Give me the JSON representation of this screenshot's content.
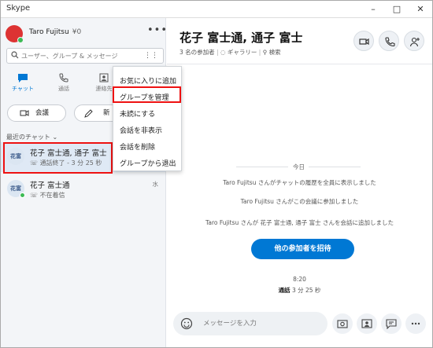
{
  "window": {
    "title": "Skype"
  },
  "profile": {
    "name": "Taro Fujitsu",
    "balance": "¥0"
  },
  "search": {
    "placeholder": "ユーザー、グループ & メッセージ"
  },
  "nav_tabs": [
    {
      "label": "チャット",
      "icon": "chat-icon"
    },
    {
      "label": "通話",
      "icon": "phone-icon"
    },
    {
      "label": "連絡先",
      "icon": "contacts-icon"
    }
  ],
  "actions": {
    "meet_label": "会議",
    "new_chat_label": "新"
  },
  "recent": {
    "title": "最近のチャット"
  },
  "chats": [
    {
      "avatar": "花富",
      "name": "花子 富士通, 通子 富士",
      "sub": "通話終了 - 3 分 25 秒",
      "time": ""
    },
    {
      "avatar": "花富",
      "name": "花子 富士通",
      "sub": "不在着信",
      "time": "水"
    }
  ],
  "context_menu": {
    "items": [
      "お気に入りに追加",
      "グループを管理",
      "未読にする",
      "会話を非表示",
      "会話を削除",
      "グループから退出"
    ],
    "highlighted": "グループを管理"
  },
  "conversation": {
    "title": "花子 富士通, 通子 富士",
    "participants": "3 名の参加者",
    "gallery": "ギャラリー",
    "search": "検索"
  },
  "messages": {
    "date_separator": "今日",
    "system": [
      "Taro Fujitsu さんがチャットの履歴を全員に表示しました",
      "Taro Fujitsu さんがこの会議に参加しました",
      "Taro Fujitsu さんが 花子 富士通, 通子 富士 さんを会話に追加しました"
    ],
    "invite_button": "他の参加者を招待",
    "call_time": "8:20",
    "call_label": "通話",
    "call_duration": "3 分 25 秒"
  },
  "composer": {
    "placeholder": "メッセージを入力"
  },
  "colors": {
    "accent": "#0078d4",
    "highlight": "#e11111",
    "online": "#3cba54",
    "sidebar_bg": "#f3f5f8"
  }
}
